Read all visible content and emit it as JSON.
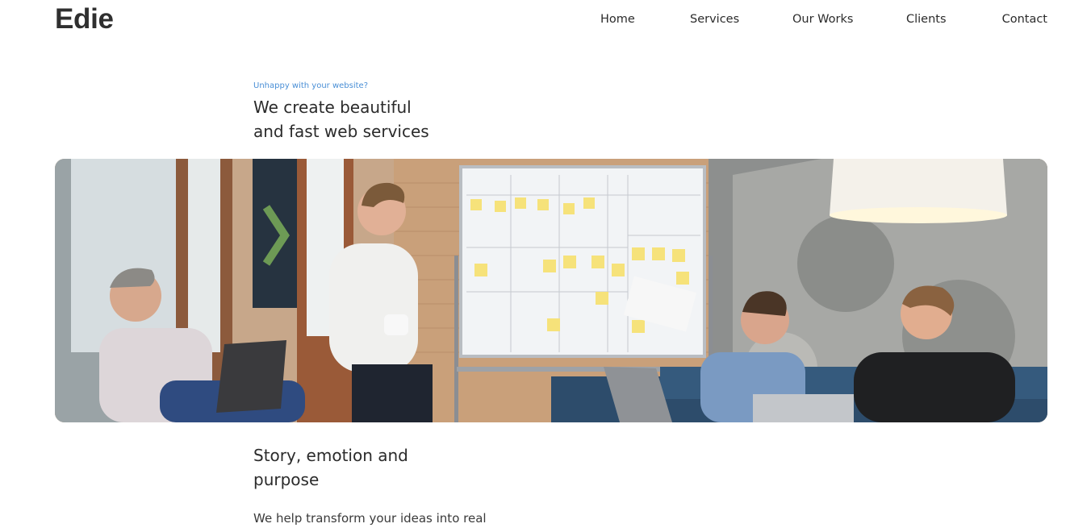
{
  "brand": {
    "name": "Edie"
  },
  "nav": {
    "items": [
      {
        "label": "Home"
      },
      {
        "label": "Services"
      },
      {
        "label": "Our Works"
      },
      {
        "label": "Clients"
      },
      {
        "label": "Contact"
      }
    ]
  },
  "hero": {
    "eyebrow": "Unhappy with your website?",
    "title_line1": "We create beautiful",
    "title_line2": "and fast web services",
    "image_subject": "team meeting in front of a kanban whiteboard"
  },
  "section": {
    "title_line1": "Story, emotion and",
    "title_line2": "purpose",
    "body": "We help transform your ideas into real"
  },
  "colors": {
    "accent": "#4a8fd6",
    "text": "#2b2b2b",
    "background": "#ffffff"
  }
}
